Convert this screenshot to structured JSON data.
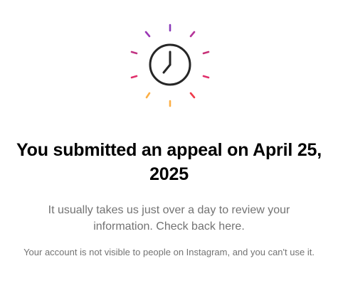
{
  "appeal": {
    "title": "You submitted an appeal on April 25, 2025",
    "subtitle": "It usually takes us just over a day to review your information. Check back here.",
    "note": "Your account is not visible to people on Instagram, and you can't use it."
  },
  "icons": {
    "main": "clock-icon",
    "decoration": "sunburst-rays"
  },
  "colors": {
    "title": "#000000",
    "body_text": "#737373",
    "ray_top": "#8a3ab9",
    "ray_upper": "#c13584",
    "ray_middle": "#e1306c",
    "ray_lower": "#fd1d1d",
    "ray_bottom": "#fcaf45"
  }
}
